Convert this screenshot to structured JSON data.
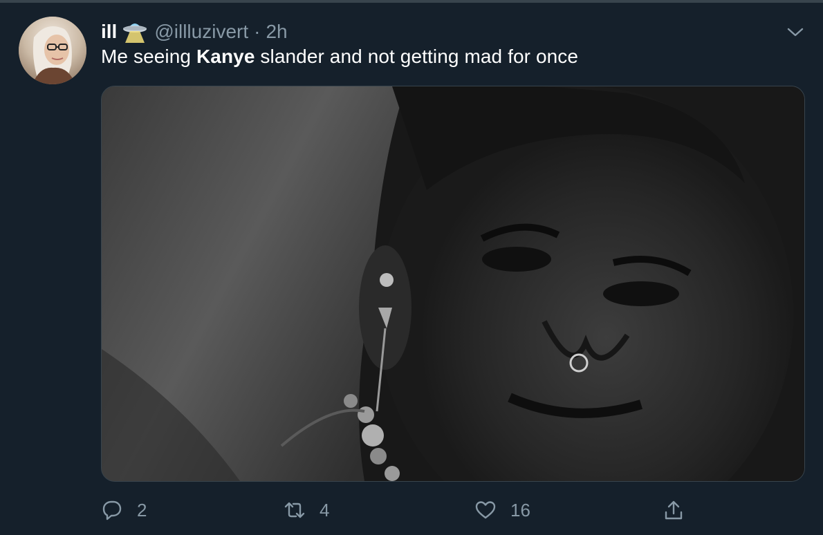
{
  "tweet": {
    "display_name": "ill",
    "emoji_icon": "ufo-icon",
    "handle": "@illluzivert",
    "separator": "·",
    "time": "2h",
    "text_before": "Me seeing ",
    "text_bold": "Kanye",
    "text_after": " slander and not getting mad for once",
    "media_description_icon": "photo"
  },
  "actions": {
    "reply_count": "2",
    "retweet_count": "4",
    "like_count": "16"
  },
  "colors": {
    "background": "#15202b",
    "secondary_text": "#8899a6",
    "border": "#38444d"
  }
}
